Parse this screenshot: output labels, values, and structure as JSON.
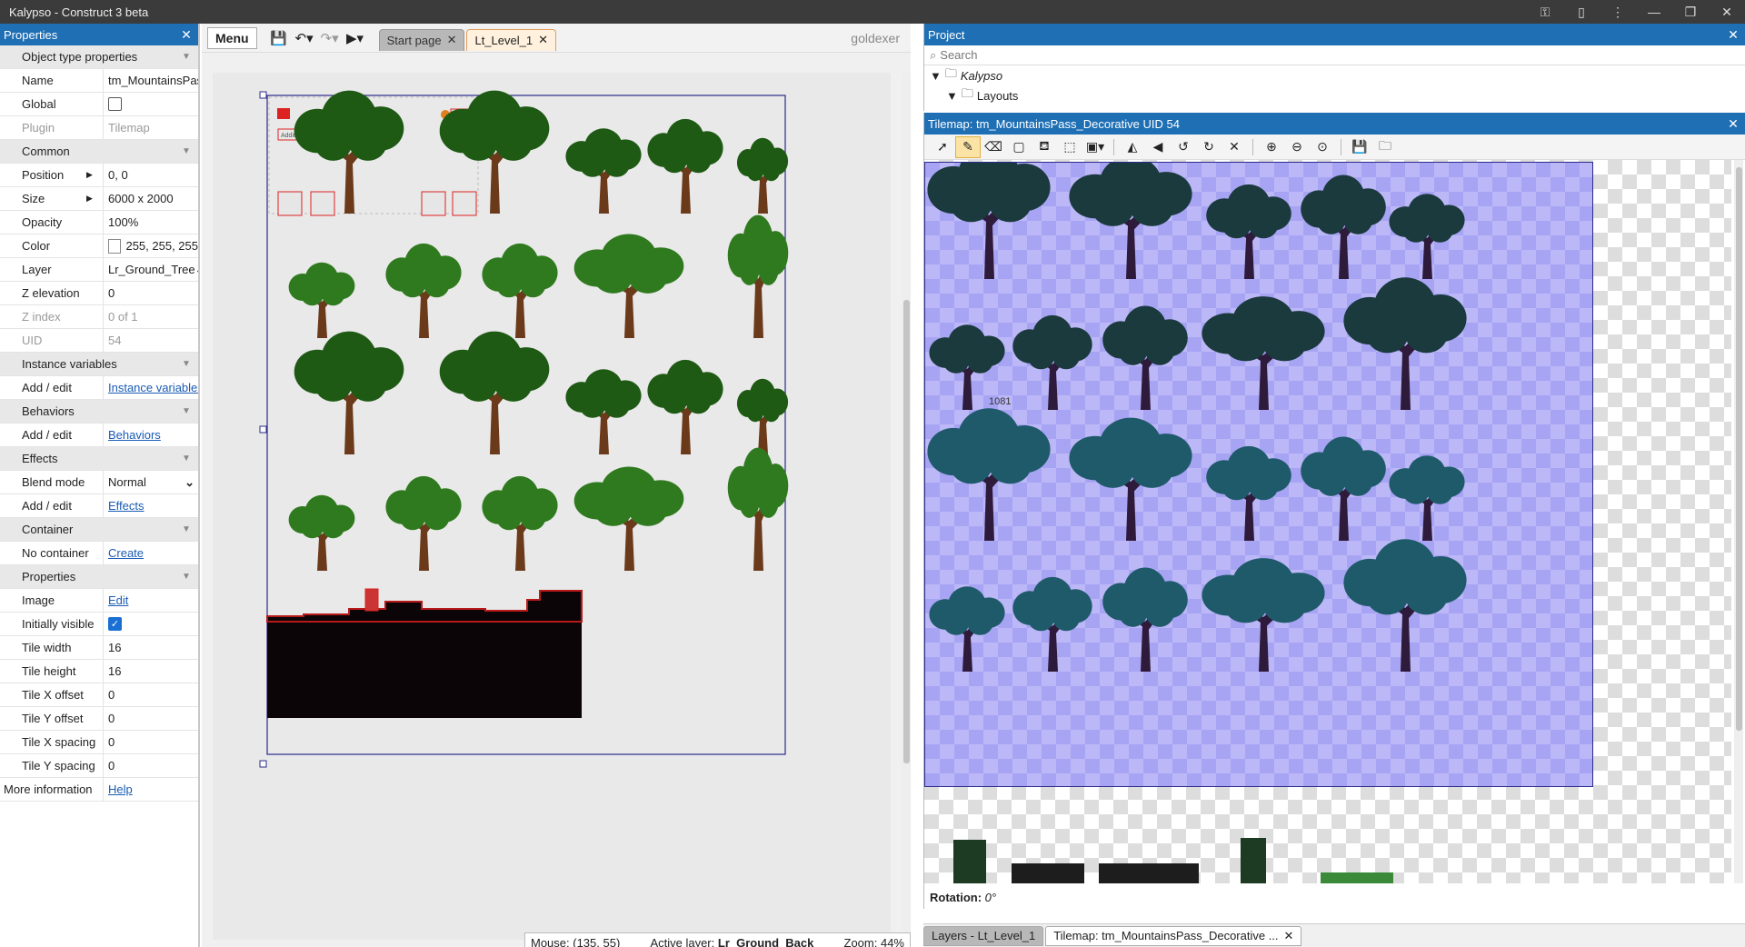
{
  "window": {
    "title": "Kalypso - Construct 3 beta"
  },
  "properties": {
    "title": "Properties",
    "rows": [
      {
        "type": "section",
        "label": "Object type properties"
      },
      {
        "type": "text",
        "label": "Name",
        "value": "tm_MountainsPass"
      },
      {
        "type": "check",
        "label": "Global",
        "checked": false
      },
      {
        "type": "disabled",
        "label": "Plugin",
        "value": "Tilemap"
      },
      {
        "type": "section",
        "label": "Common"
      },
      {
        "type": "expand",
        "label": "Position",
        "value": "0, 0"
      },
      {
        "type": "expand",
        "label": "Size",
        "value": "6000 x 2000"
      },
      {
        "type": "text",
        "label": "Opacity",
        "value": "100%"
      },
      {
        "type": "color",
        "label": "Color",
        "value": "255, 255, 255"
      },
      {
        "type": "select",
        "label": "Layer",
        "value": "Lr_Ground_Tree"
      },
      {
        "type": "text",
        "label": "Z elevation",
        "value": "0"
      },
      {
        "type": "disabled",
        "label": "Z index",
        "value": "0 of 1"
      },
      {
        "type": "disabled",
        "label": "UID",
        "value": "54"
      },
      {
        "type": "section",
        "label": "Instance variables"
      },
      {
        "type": "link",
        "label": "Add / edit",
        "value": "Instance variables"
      },
      {
        "type": "section",
        "label": "Behaviors"
      },
      {
        "type": "link",
        "label": "Add / edit",
        "value": "Behaviors"
      },
      {
        "type": "section",
        "label": "Effects"
      },
      {
        "type": "select",
        "label": "Blend mode",
        "value": "Normal"
      },
      {
        "type": "link",
        "label": "Add / edit",
        "value": "Effects"
      },
      {
        "type": "section",
        "label": "Container"
      },
      {
        "type": "link",
        "label": "No container",
        "value": "Create"
      },
      {
        "type": "section",
        "label": "Properties"
      },
      {
        "type": "link",
        "label": "Image",
        "value": "Edit"
      },
      {
        "type": "check",
        "label": "Initially visible",
        "checked": true
      },
      {
        "type": "text",
        "label": "Tile width",
        "value": "16"
      },
      {
        "type": "text",
        "label": "Tile height",
        "value": "16"
      },
      {
        "type": "text",
        "label": "Tile X offset",
        "value": "0"
      },
      {
        "type": "text",
        "label": "Tile Y offset",
        "value": "0"
      },
      {
        "type": "text",
        "label": "Tile X spacing",
        "value": "0"
      },
      {
        "type": "text",
        "label": "Tile Y spacing",
        "value": "0"
      },
      {
        "type": "linkwide",
        "label": "More information",
        "value": "Help"
      }
    ]
  },
  "editor": {
    "menu_label": "Menu",
    "tabs": [
      {
        "label": "Start page",
        "active": false
      },
      {
        "label": "Lt_Level_1",
        "active": true
      }
    ],
    "user": "goldexer",
    "hud_text": "Additional info",
    "status": {
      "mouse": "Mouse: (135, 55)",
      "active_layer_label": "Active layer:",
      "active_layer": "Lr_Ground_Back",
      "zoom": "Zoom: 44%"
    }
  },
  "project": {
    "title": "Project",
    "search_placeholder": "Search",
    "tree": [
      {
        "label": "Kalypso",
        "italic": true,
        "level": 0
      },
      {
        "label": "Layouts",
        "italic": false,
        "level": 1
      }
    ]
  },
  "tilemap": {
    "title": "Tilemap: tm_MountainsPass_Decorative UID 54",
    "rotation_label": "Rotation:",
    "rotation_value": "0°",
    "tile_label": "1081"
  },
  "bottom_tabs": [
    {
      "label": "Layers - Lt_Level_1",
      "active": false
    },
    {
      "label": "Tilemap: tm_MountainsPass_Decorative ...",
      "active": true
    }
  ],
  "colors": {
    "panel_header": "#1f6fb4",
    "tab_active": "#fff1de",
    "tileset_bg": "#a8a4f4",
    "tree_green": "#2f7a1e",
    "tree_teal": "#1f5a6a",
    "trunk": "#6b3a1a"
  }
}
